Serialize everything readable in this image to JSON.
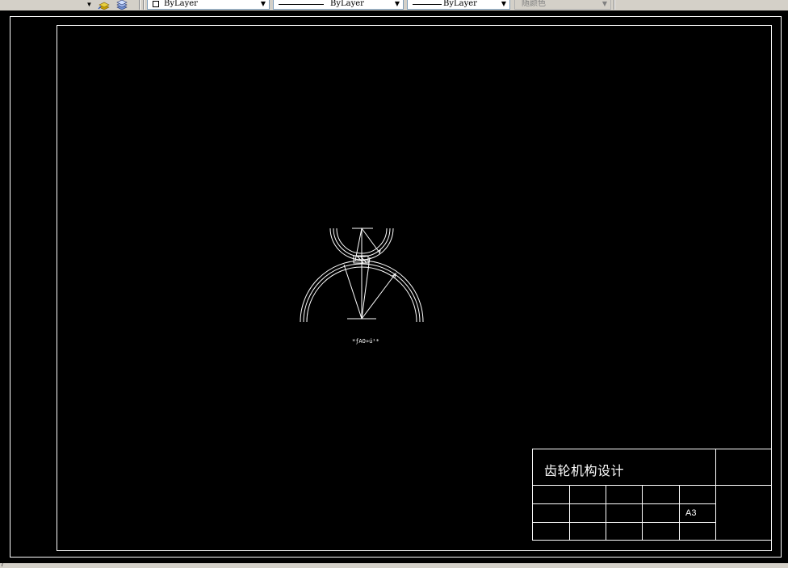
{
  "toolbar": {
    "color_combo": "ByLayer",
    "linetype_combo": "ByLayer",
    "lineweight_combo": "ByLayer",
    "plotstyle_combo": "随颜色"
  },
  "drawing": {
    "caption": "*ƒAO»ú¹*"
  },
  "title_block": {
    "title": "齿轮机构设计",
    "sheet_size": "A3"
  },
  "icons": [
    "dropdown-arrow-icon",
    "layer-make-current-icon",
    "layer-previous-icon",
    "color-swatch-icon"
  ]
}
